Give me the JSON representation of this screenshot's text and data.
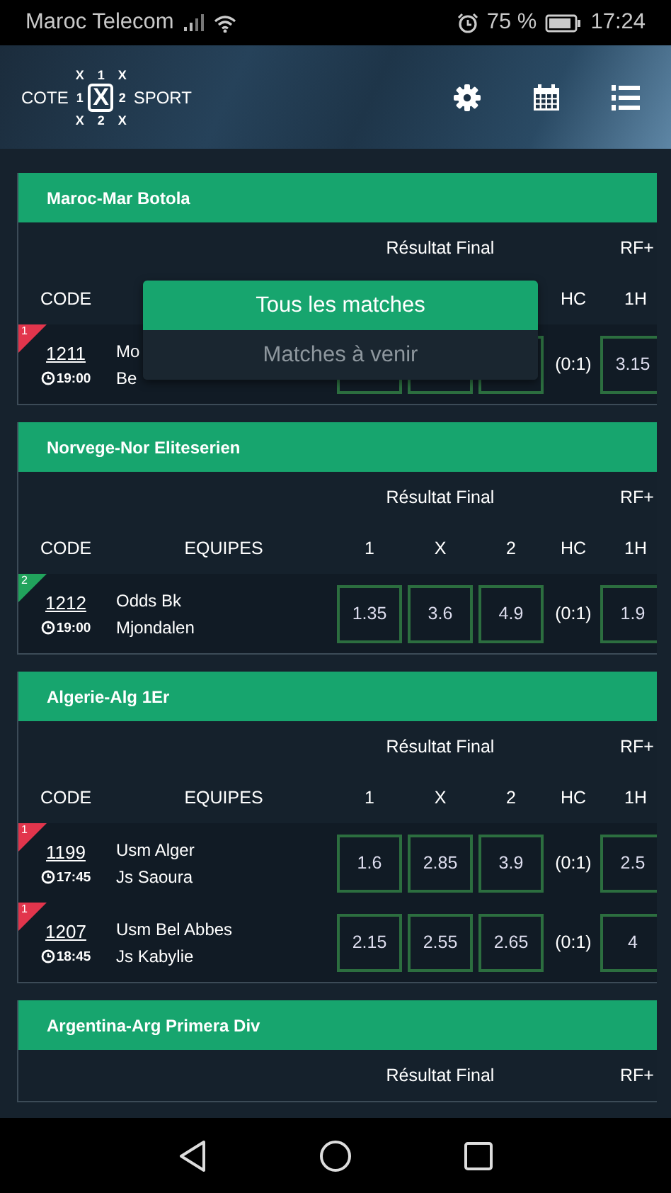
{
  "status_bar": {
    "carrier": "Maroc Telecom",
    "battery_text": "75 %",
    "time": "17:24"
  },
  "header": {
    "logo": {
      "left": "COTE",
      "right": "SPORT",
      "grid": [
        "X",
        "1",
        "X",
        "1",
        "X",
        "2",
        "X",
        "2",
        "X"
      ]
    }
  },
  "leagues": [
    {
      "name": "Maroc-Mar Botola",
      "group_labels": [
        "Résultat Final",
        "RF+"
      ],
      "columns": {
        "code": "CODE",
        "hc": "HC",
        "h1": "1H"
      },
      "matches": [
        {
          "rank": "1",
          "color": "#e2354c",
          "code": "1211",
          "time": "19:00",
          "teams": [
            "Mo",
            "Be"
          ],
          "hc": "(0:1)",
          "h1": "3.15"
        }
      ]
    },
    {
      "name": "Norvege-Nor Eliteserien",
      "group_labels": [
        "Résultat Final",
        "RF+"
      ],
      "columns": {
        "code": "CODE",
        "teams": "EQUIPES",
        "c1": "1",
        "cx": "X",
        "c2": "2",
        "hc": "HC",
        "h1": "1H"
      },
      "matches": [
        {
          "rank": "2",
          "color": "#21a35c",
          "code": "1212",
          "time": "19:00",
          "teams": [
            "Odds Bk",
            "Mjondalen"
          ],
          "odds": [
            "1.35",
            "3.6",
            "4.9"
          ],
          "hc": "(0:1)",
          "h1": "1.9"
        }
      ]
    },
    {
      "name": "Algerie-Alg 1Er",
      "group_labels": [
        "Résultat Final",
        "RF+"
      ],
      "columns": {
        "code": "CODE",
        "teams": "EQUIPES",
        "c1": "1",
        "cx": "X",
        "c2": "2",
        "hc": "HC",
        "h1": "1H"
      },
      "matches": [
        {
          "rank": "1",
          "color": "#e2354c",
          "code": "1199",
          "time": "17:45",
          "teams": [
            "Usm Alger",
            "Js Saoura"
          ],
          "odds": [
            "1.6",
            "2.85",
            "3.9"
          ],
          "hc": "(0:1)",
          "h1": "2.5"
        },
        {
          "rank": "1",
          "color": "#e2354c",
          "code": "1207",
          "time": "18:45",
          "teams": [
            "Usm Bel Abbes",
            "Js Kabylie"
          ],
          "odds": [
            "2.15",
            "2.55",
            "2.65"
          ],
          "hc": "(0:1)",
          "h1": "4"
        }
      ]
    },
    {
      "name": "Argentina-Arg Primera Div",
      "group_labels": [
        "Résultat Final",
        "RF+"
      ]
    }
  ],
  "filter_menu": [
    {
      "label": "Tous les matches",
      "selected": true
    },
    {
      "label": "Matches à venir",
      "selected": false
    }
  ]
}
